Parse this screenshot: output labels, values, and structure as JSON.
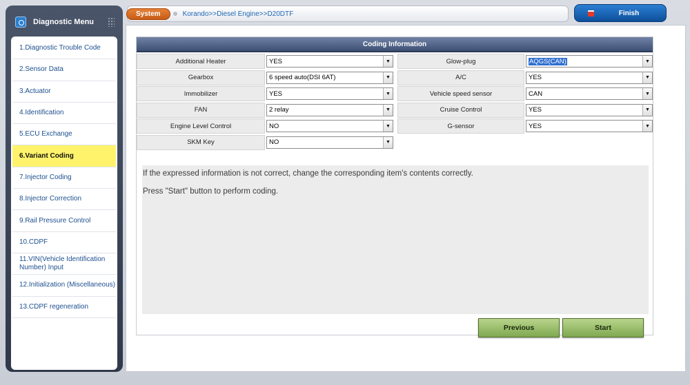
{
  "sidebar": {
    "title": "Diagnostic Menu",
    "items": [
      {
        "label": "1.Diagnostic Trouble Code",
        "active": false
      },
      {
        "label": "2.Sensor Data",
        "active": false
      },
      {
        "label": "3.Actuator",
        "active": false
      },
      {
        "label": "4.Identification",
        "active": false
      },
      {
        "label": "5.ECU Exchange",
        "active": false
      },
      {
        "label": "6.Variant Coding",
        "active": true
      },
      {
        "label": "7.Injector Coding",
        "active": false
      },
      {
        "label": "8.Injector Correction",
        "active": false
      },
      {
        "label": "9.Rail Pressure Control",
        "active": false
      },
      {
        "label": "10.CDPF",
        "active": false
      },
      {
        "label": "11.VIN(Vehicle Identification Number) Input",
        "active": false
      },
      {
        "label": "12.Initialization (Miscellaneous)",
        "active": false
      },
      {
        "label": "13.CDPF regeneration",
        "active": false
      }
    ]
  },
  "header": {
    "system_label": "System",
    "breadcrumb": "Korando>>Diesel Engine>>D20DTF",
    "finish_label": "Finish"
  },
  "panel": {
    "title": "Coding Information",
    "left_fields": [
      {
        "label": "Additional Heater",
        "value": "YES"
      },
      {
        "label": "Gearbox",
        "value": "6 speed auto(DSI 6AT)"
      },
      {
        "label": "Immobilizer",
        "value": "YES"
      },
      {
        "label": "FAN",
        "value": "2 relay"
      },
      {
        "label": "Engine Level Control",
        "value": "NO"
      },
      {
        "label": "SKM Key",
        "value": "NO"
      }
    ],
    "right_fields": [
      {
        "label": "Glow-plug",
        "value": "AQGS(CAN)",
        "selected": true
      },
      {
        "label": "A/C",
        "value": "YES"
      },
      {
        "label": "Vehicle speed sensor",
        "value": "CAN"
      },
      {
        "label": "Cruise Control",
        "value": "YES"
      },
      {
        "label": "G-sensor",
        "value": "YES"
      }
    ],
    "messages": [
      "If the expressed information is not correct, change the corresponding item's contents correctly.",
      "Press \"Start\" button to perform coding."
    ]
  },
  "buttons": {
    "previous": "Previous",
    "start": "Start"
  },
  "colors": {
    "accent": "#2c7fd4",
    "active_menu": "#fff36b",
    "system_badge": "#d96a22",
    "action_button": "#9dbf6c"
  }
}
